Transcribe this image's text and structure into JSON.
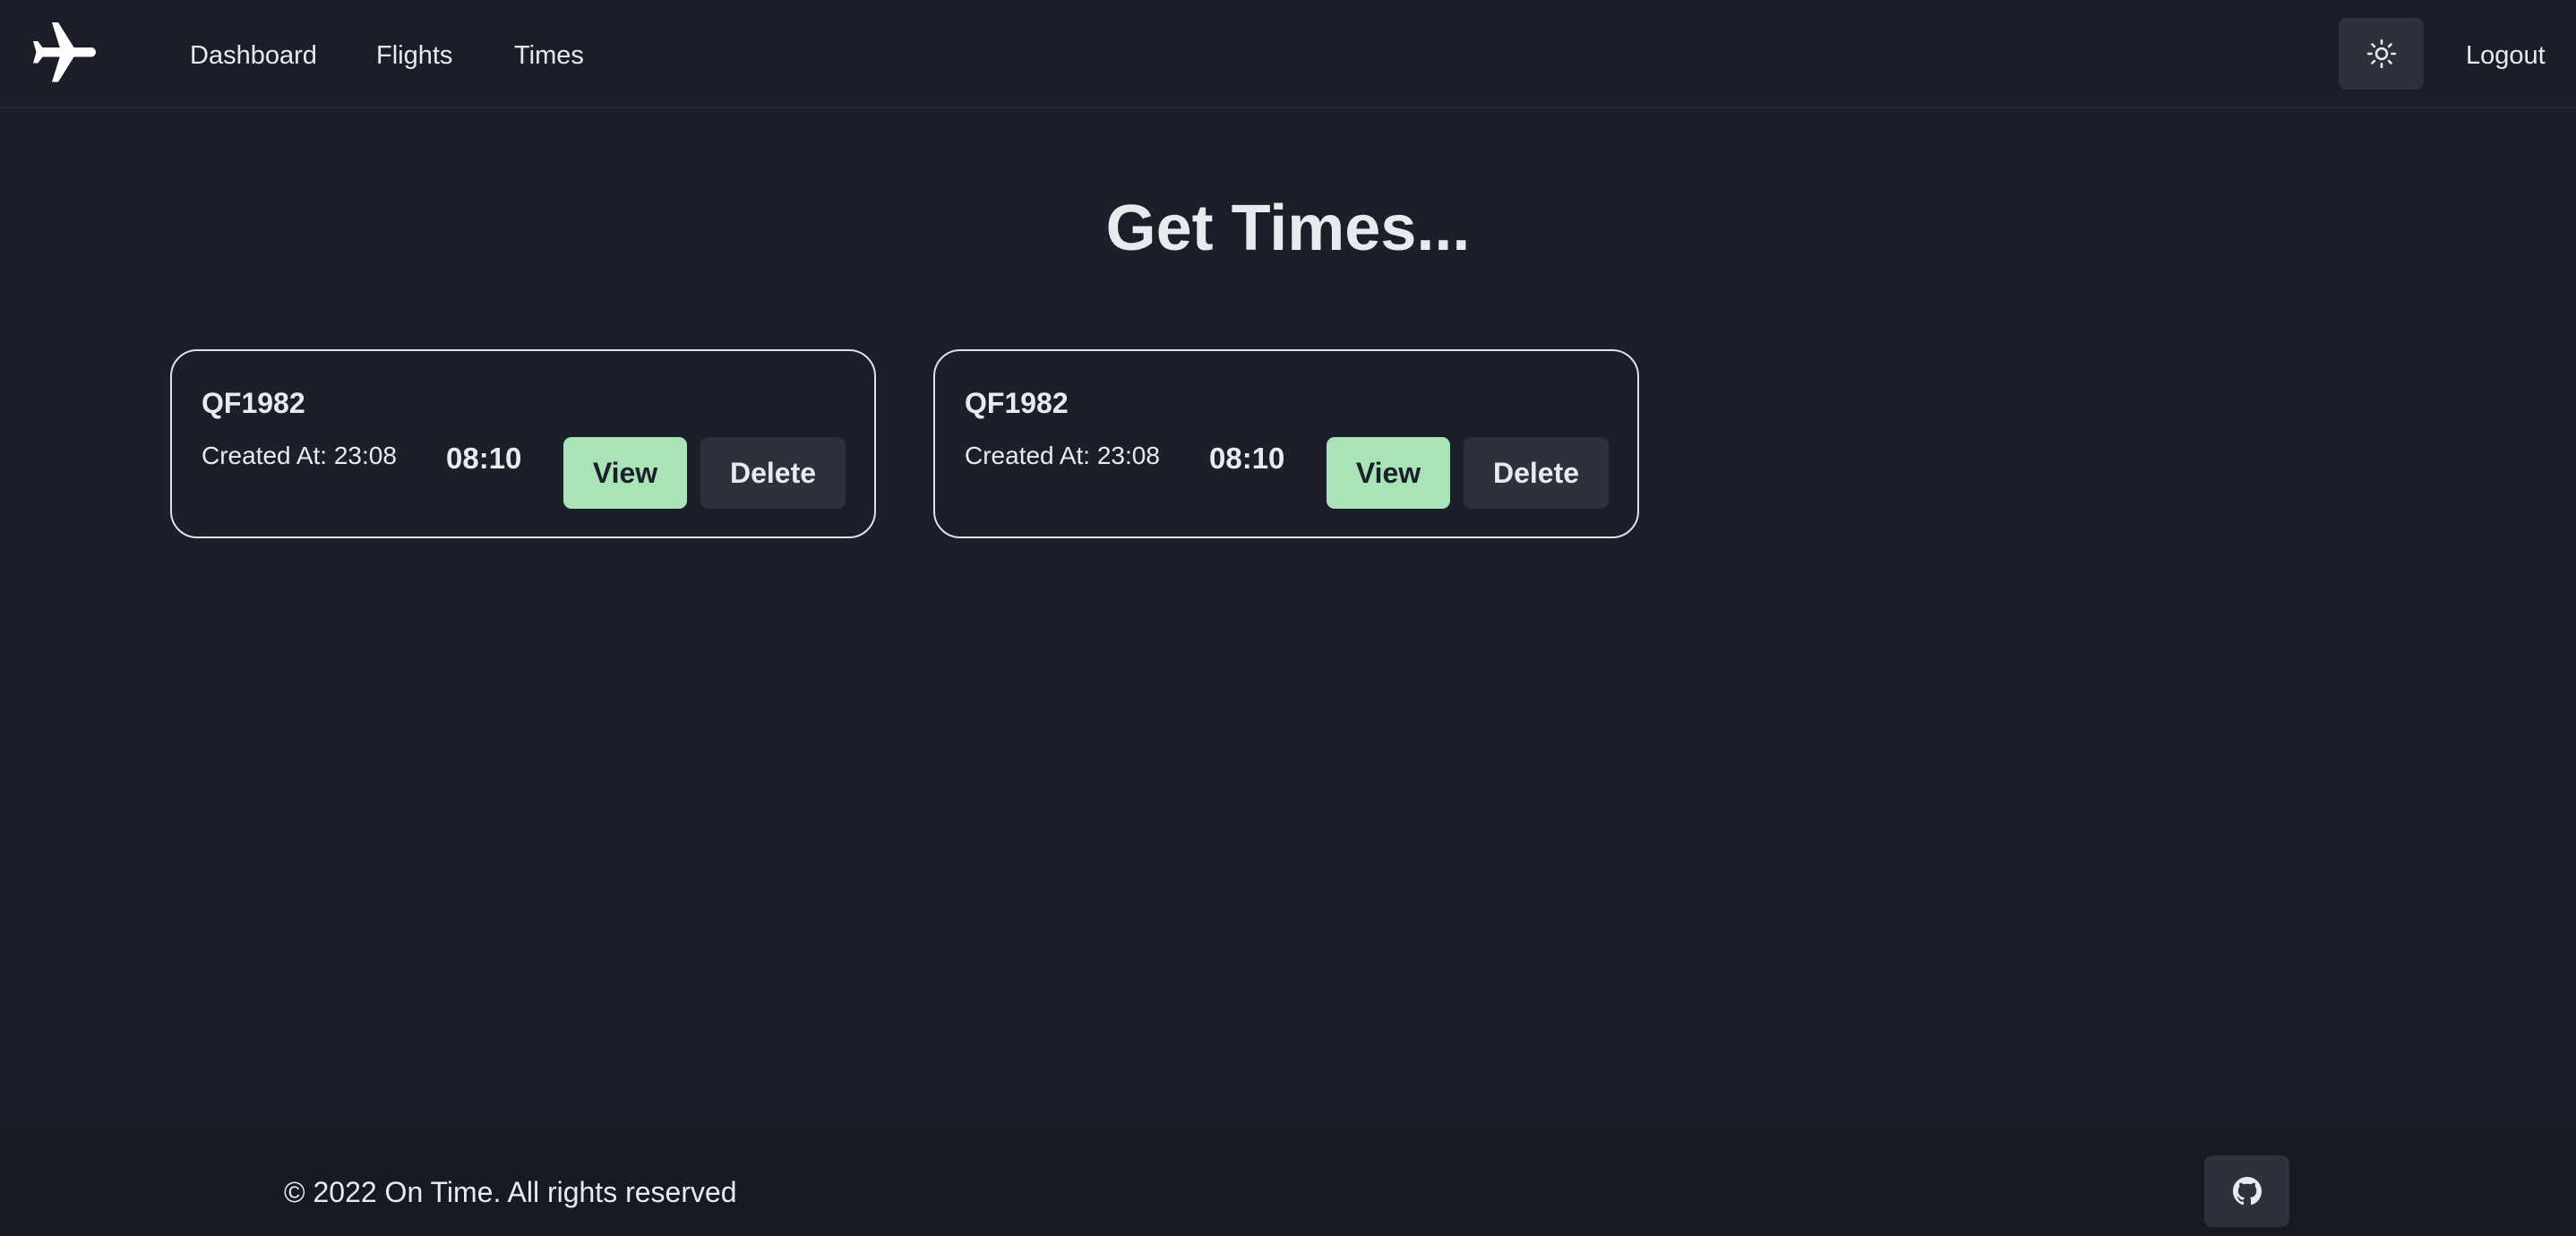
{
  "nav": {
    "logo_icon": "airplane-icon",
    "links": [
      "Dashboard",
      "Flights",
      "Times"
    ],
    "theme_icon": "sun-icon",
    "logout_label": "Logout"
  },
  "main": {
    "title": "Get Times...",
    "cards": [
      {
        "flight_code": "QF1982",
        "created_at": "Created At: 23:08",
        "time": "08:10",
        "view_label": "View",
        "delete_label": "Delete"
      },
      {
        "flight_code": "QF1982",
        "created_at": "Created At: 23:08",
        "time": "08:10",
        "view_label": "View",
        "delete_label": "Delete"
      }
    ]
  },
  "footer": {
    "copyright": "© 2022 On Time. All rights reserved",
    "github_icon": "github-icon"
  },
  "colors": {
    "background": "#1c1f2a",
    "navbar": "#1b1e28",
    "footer": "#171a22",
    "button_secondary": "#2d313c",
    "accent_green": "#a8e4b8",
    "text": "#e8eaed"
  }
}
